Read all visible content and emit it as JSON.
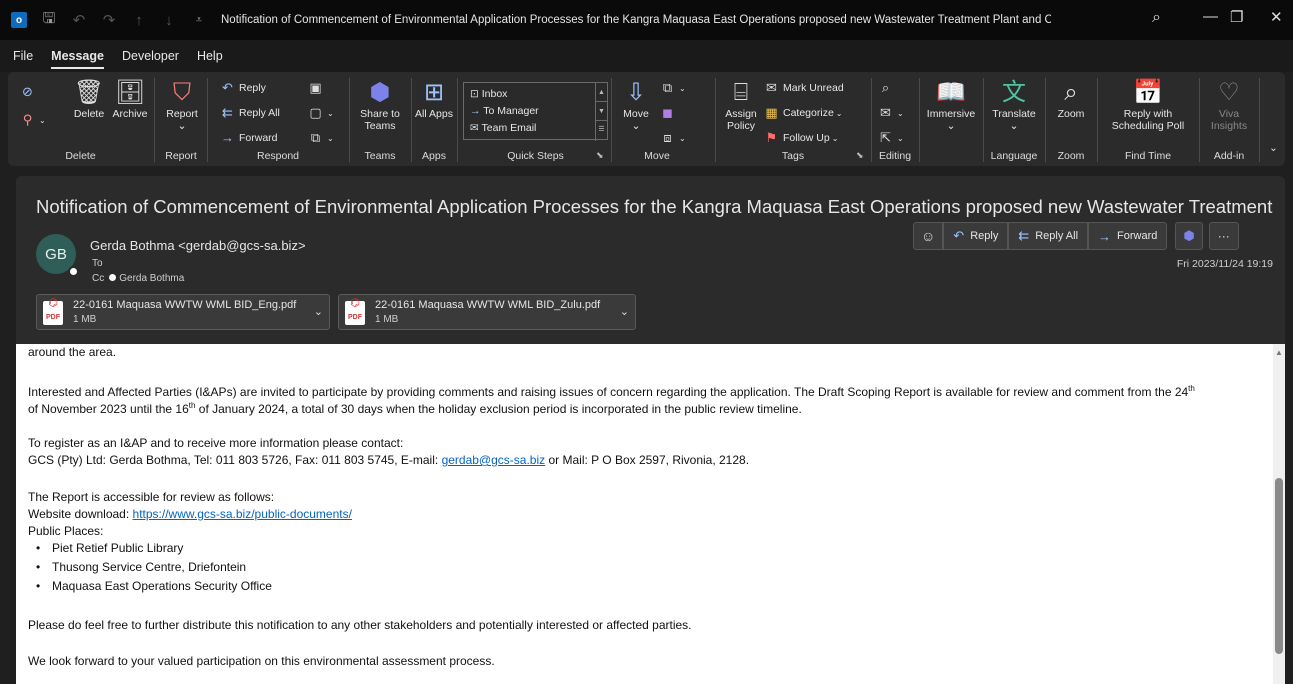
{
  "window": {
    "title": "Notification of Commencement of Environmental Application Processes for the Kangra Maquasa East Operations proposed new Wastewater Treatment Plant and Co-disposa..."
  },
  "menu": [
    "File",
    "Message",
    "Developer",
    "Help"
  ],
  "ribbon": {
    "delete": {
      "delete": "Delete",
      "archive": "Archive",
      "label": "Delete"
    },
    "report": {
      "report": "Report",
      "label": "Report"
    },
    "respond": {
      "reply": "Reply",
      "reply_all": "Reply All",
      "forward": "Forward",
      "label": "Respond"
    },
    "teams": {
      "share": "Share to Teams",
      "label": "Teams"
    },
    "apps": {
      "all_apps": "All Apps",
      "label": "Apps"
    },
    "quick_steps": {
      "items": [
        "Inbox",
        "To Manager",
        "Team Email"
      ],
      "label": "Quick Steps"
    },
    "move": {
      "move": "Move",
      "label": "Move"
    },
    "tags": {
      "assign_policy": "Assign Policy",
      "mark_unread": "Mark Unread",
      "categorize": "Categorize",
      "follow_up": "Follow Up",
      "label": "Tags"
    },
    "editing": {
      "label": "Editing"
    },
    "immersive": {
      "immersive": "Immersive"
    },
    "language": {
      "translate": "Translate",
      "label": "Language"
    },
    "zoom": {
      "zoom": "Zoom",
      "label": "Zoom"
    },
    "find_time": {
      "reply_poll": "Reply with Scheduling Poll",
      "label": "Find Time"
    },
    "addin": {
      "viva": "Viva Insights",
      "label": "Add-in"
    }
  },
  "message": {
    "subject": "Notification of Commencement of Environmental Application Processes for the Kangra Maquasa East Operations proposed new Wastewater Treatment P...",
    "avatar_initials": "GB",
    "sender": "Gerda Bothma <gerdab@gcs-sa.biz>",
    "to_label": "To",
    "cc_label": "Cc",
    "cc_name": "Gerda Bothma",
    "date": "Fri 2023/11/24 19:19",
    "actions": {
      "reply": "Reply",
      "reply_all": "Reply All",
      "forward": "Forward"
    },
    "attachments": [
      {
        "name": "22-0161 Maquasa WWTW  WML BID_Eng.pdf",
        "size": "1 MB",
        "type": "PDF"
      },
      {
        "name": "22-0161 Maquasa WWTW  WML BID_Zulu.pdf",
        "size": "1 MB",
        "type": "PDF"
      }
    ]
  },
  "body": {
    "p0": "around the area.",
    "p1_a": "Interested and Affected Parties (I&APs) are invited to participate by providing comments and raising issues of concern regarding the application. The Draft Scoping Report is available for review and comment from the 24",
    "p1_sup1": "th",
    "p1_b": "of November 2023 until the 16",
    "p1_sup2": "th",
    "p1_c": " of January 2024, a total of 30 days when the holiday exclusion period is incorporated in the public review timeline.",
    "p2": "To register as an I&AP and to receive more information please contact:",
    "p3_a": "GCS (Pty) Ltd: Gerda Bothma, Tel: 011 803 5726, Fax: 011 803 5745, E-mail: ",
    "p3_link": "gerdab@gcs-sa.biz",
    "p3_b": " or Mail: P O Box 2597, Rivonia, 2128.",
    "p4": "The Report is accessible for review as follows:",
    "p5_a": "Website download: ",
    "p5_link": "https://www.gcs-sa.biz/public-documents/",
    "p6": "Public Places:",
    "places": [
      "Piet Retief Public Library",
      "Thusong Service Centre, Driefontein",
      "Maquasa East Operations Security Office"
    ],
    "p7": "Please do feel free to further distribute this notification to any other stakeholders and potentially interested or affected parties.",
    "p8": "We look forward to your valued participation on this environmental assessment process."
  }
}
